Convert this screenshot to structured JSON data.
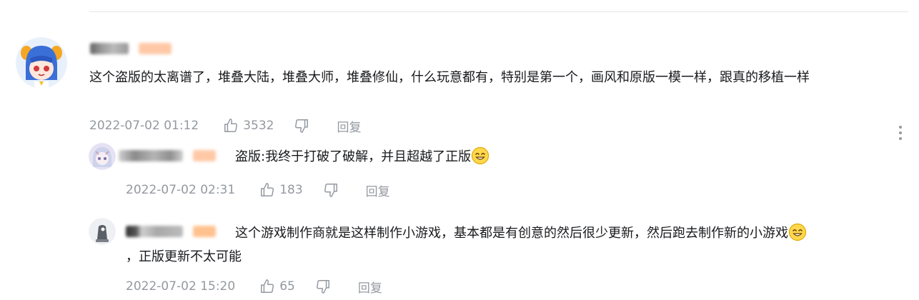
{
  "main_comment": {
    "text": "这个盗版的太离谱了，堆叠大陆，堆叠大师，堆叠修仙，什么玩意都有，特别是第一个，画风和原版一模一样，跟真的移植一样",
    "time": "2022-07-02 01:12",
    "likes": "3532",
    "reply_label": "回复"
  },
  "replies": [
    {
      "text": "盗版:我终于打破了破解，并且超越了正版",
      "time": "2022-07-02 02:31",
      "likes": "183",
      "reply_label": "回复"
    },
    {
      "text_line1": "这个游戏制作商就是这样制作小游戏，基本都是有创意的然后很少更新，然后跑去制作新的小游戏",
      "text_line2": "，正版更新不太可能",
      "time": "2022-07-02 15:20",
      "likes": "65",
      "reply_label": "回复"
    }
  ],
  "colors": {
    "text": "#18191c",
    "meta": "#9499a0",
    "divider": "#e3e5e7",
    "level_badge": "#ffb48a"
  },
  "icons": {
    "like": "thumbs-up-icon",
    "dislike": "thumbs-down-icon",
    "more": "more-vertical-icon",
    "emoji": "smiling-face-emoji"
  }
}
